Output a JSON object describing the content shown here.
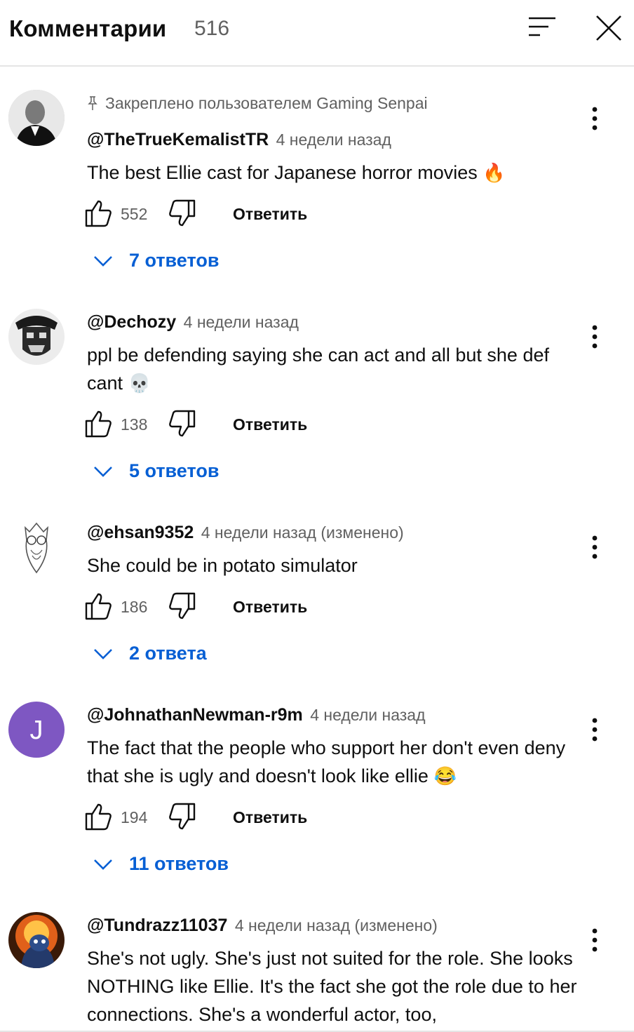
{
  "header": {
    "title": "Комментарии",
    "count": "516"
  },
  "comments": [
    {
      "pinned": "Закреплено пользователем Gaming Senpai",
      "author": "@TheTrueKemalistTR",
      "time": "4 недели назад",
      "text": "The best Ellie cast for Japanese horror movies",
      "emoji": "🔥",
      "likes": "552",
      "reply": "Ответить",
      "replies": "7 ответов"
    },
    {
      "author": "@Dechozy",
      "time": "4 недели назад",
      "text": "ppl be defending saying she can act and all but she def cant",
      "emoji": "💀",
      "likes": "138",
      "reply": "Ответить",
      "replies": "5 ответов"
    },
    {
      "author": "@ehsan9352",
      "time": "4 недели назад (изменено)",
      "text": "She could be in potato simulator",
      "likes": "186",
      "reply": "Ответить",
      "replies": "2 ответа"
    },
    {
      "author": "@JohnathanNewman-r9m",
      "time": "4 недели назад",
      "avatar_letter": "J",
      "avatar_color": "#7e57c2",
      "text": "The fact that the people who support her don't even deny that she is ugly and doesn't look like ellie",
      "emoji": "😂",
      "likes": "194",
      "reply": "Ответить",
      "replies": "11 ответов"
    },
    {
      "author": "@Tundrazz11037",
      "time": "4 недели назад (изменено)",
      "text": "She's not ugly. She's just not suited for the role. She looks NOTHING like Ellie. It's the fact she got the role due to her connections. She's a wonderful actor, too,"
    }
  ],
  "colors": {
    "link": "#065fd4",
    "secondary": "#606060",
    "divider": "#e5e5e5"
  }
}
